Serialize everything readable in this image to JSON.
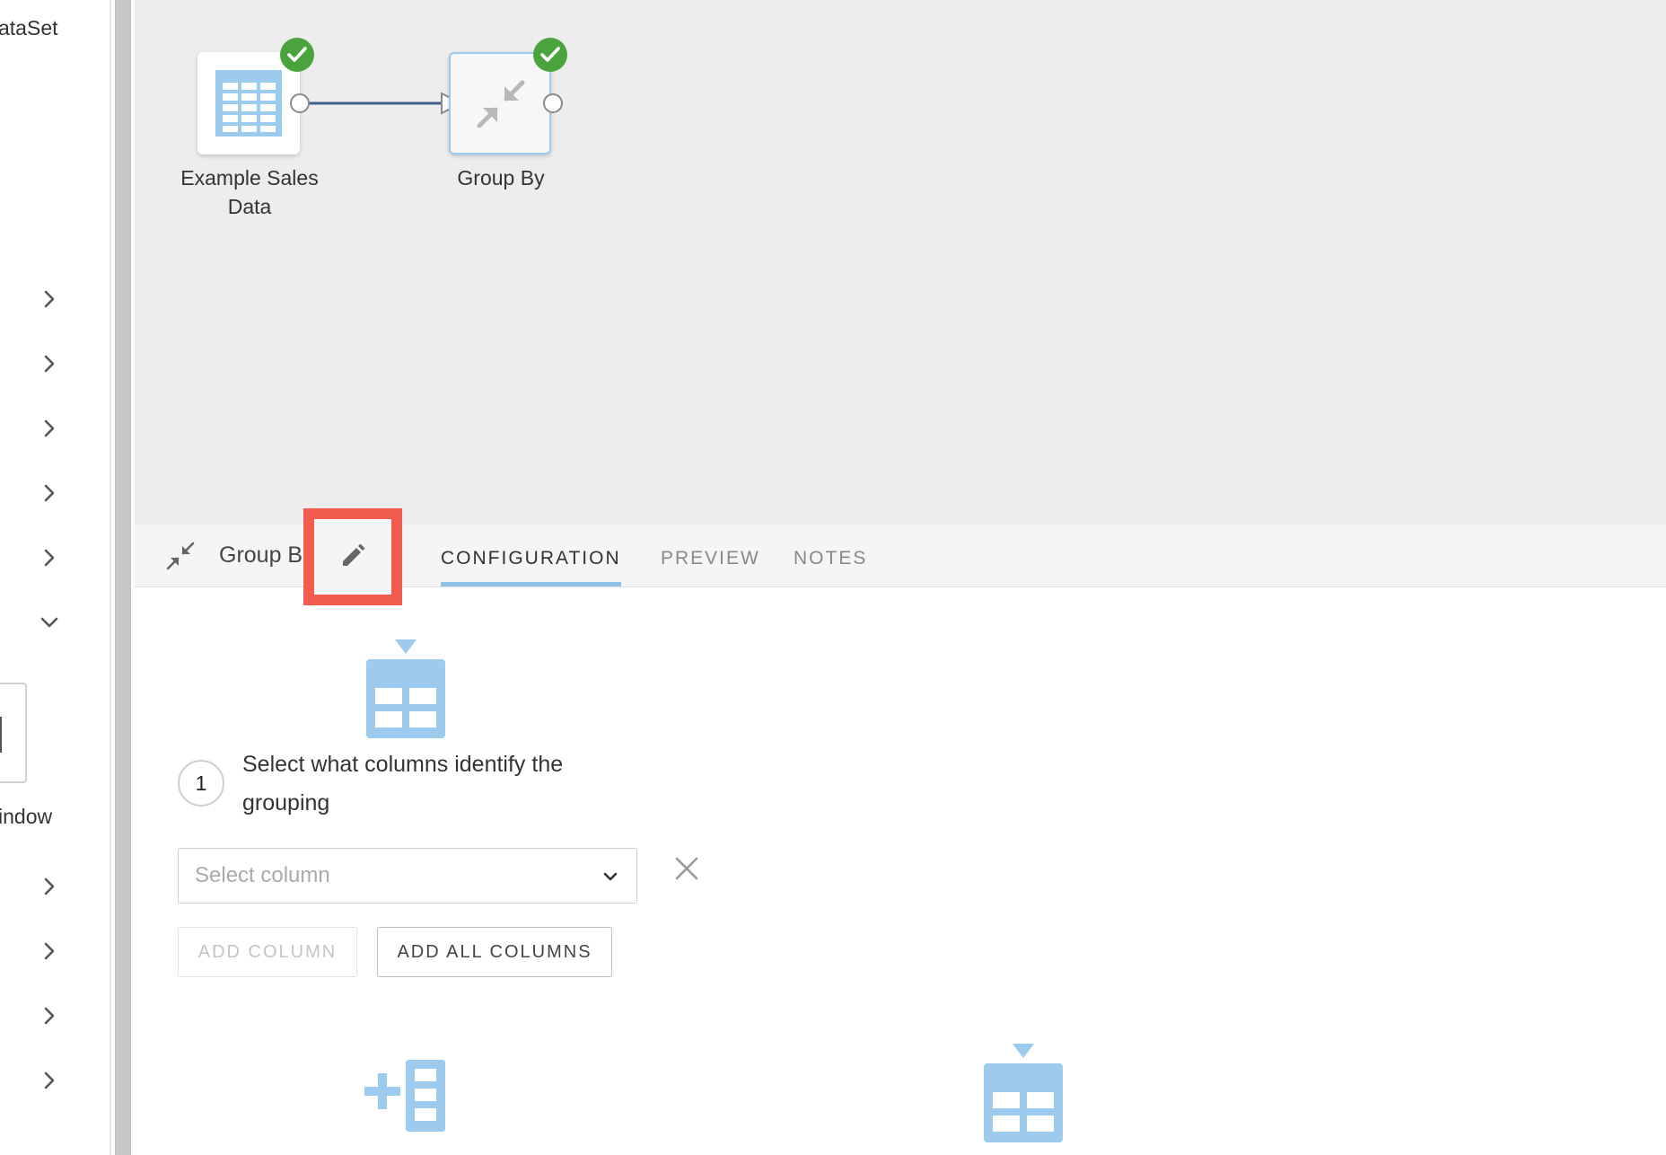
{
  "sidebar": {
    "clipped_title": "ataSet",
    "clipped_window_label": "indow"
  },
  "canvas": {
    "nodes": [
      {
        "label_line1": "Example Sales",
        "label_line2": "Data",
        "status": "complete"
      },
      {
        "label": "Group By",
        "status": "complete"
      }
    ]
  },
  "panel": {
    "title": "Group B",
    "tabs": [
      {
        "label": "CONFIGURATION",
        "active": true
      },
      {
        "label": "PREVIEW",
        "active": false
      },
      {
        "label": "NOTES",
        "active": false
      }
    ],
    "step1": {
      "number": "1",
      "text": "Select what columns identify the grouping"
    },
    "select": {
      "placeholder": "Select column"
    },
    "buttons": {
      "add_column": "ADD COLUMN",
      "add_all_columns": "ADD ALL COLUMNS"
    }
  },
  "colors": {
    "accent_blue": "#8fc3ea",
    "icon_blue": "#9ccbee",
    "success_green": "#4aa33c",
    "highlight_red": "#f25c4f",
    "canvas_bg": "#ededed"
  }
}
